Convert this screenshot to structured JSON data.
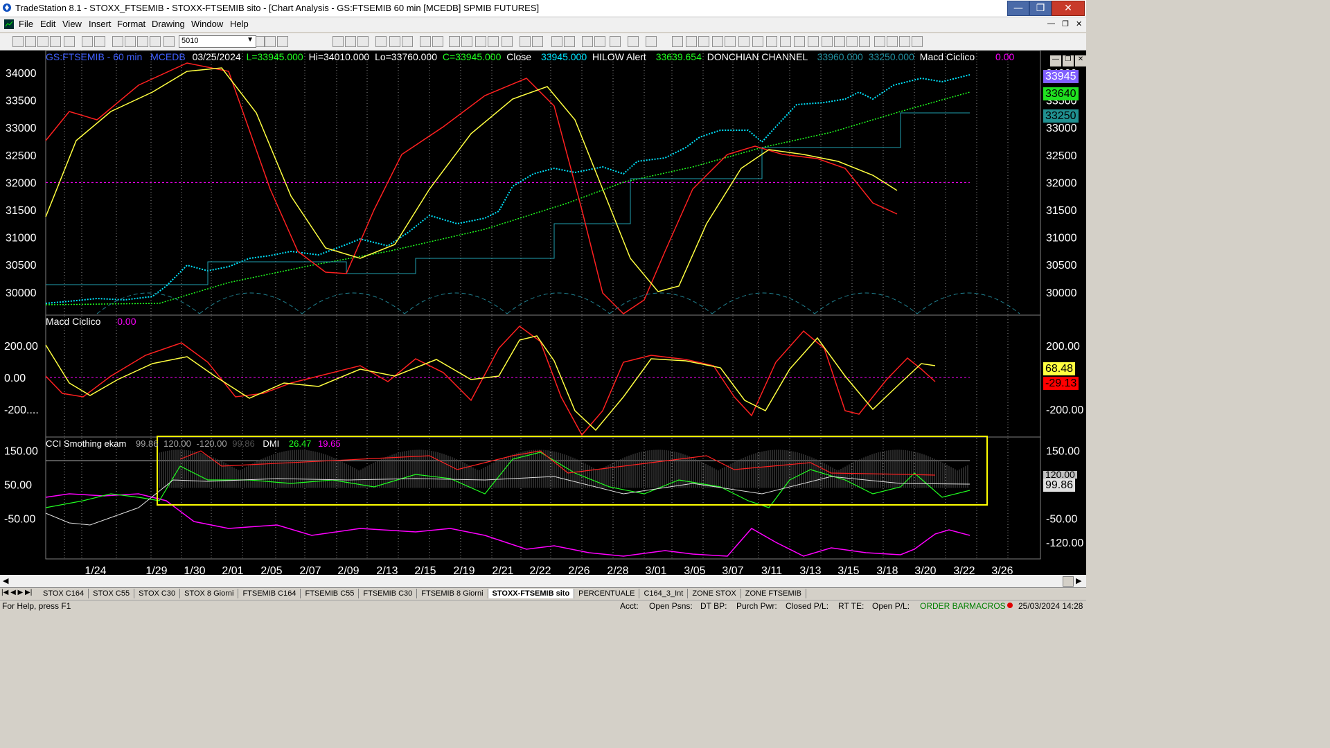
{
  "window": {
    "title": "TradeStation 8.1 - STOXX_FTSEMIB - STOXX-FTSEMIB sito - [Chart Analysis - GS:FTSEMIB  60 min  [MCEDB] SPMIB FUTURES]"
  },
  "menu": [
    "File",
    "View",
    "Insert",
    "Format",
    "Drawing",
    "Window",
    "Help"
  ],
  "toolbar": {
    "symbol_value": "5010"
  },
  "header": {
    "symbol": "GS:FTSEMIB - 60 min",
    "feed": "MCEDB",
    "date": "03/25/2024",
    "last": "L=33945.000",
    "hi": "Hi=34010.000",
    "lo": "Lo=33760.000",
    "close_c": "C=33945.000",
    "close_label": "Close",
    "close_val": "33945.000",
    "hilow_label": "HILOW Alert",
    "hilow_val": "33639.654",
    "donch_label": "DONCHIAN CHANNEL",
    "donch_hi": "33960.000",
    "donch_lo": "33250.000",
    "macd_label": "Macd Ciclico",
    "macd_val": "0.00"
  },
  "price_axis": [
    "34000",
    "33500",
    "33000",
    "32500",
    "32000",
    "31500",
    "31000",
    "30500",
    "30000"
  ],
  "price_boxes": {
    "last": "33945",
    "hilow": "33640",
    "donch_lo": "33250"
  },
  "macd_panel": {
    "label": "Macd Ciclico",
    "value": "0.00",
    "axis": [
      "200.00",
      "0.00",
      "-200...."
    ],
    "right_axis": [
      "200.00",
      "-200.00"
    ],
    "box1": "68.48",
    "box2": "-29.13"
  },
  "cci_panel": {
    "label": "CCI Smothing ekam",
    "v1": "99.86",
    "v2": "120.00",
    "v3": "-120.00",
    "v4": "99.86",
    "dmi_label": "DMI",
    "dmi1": "26.47",
    "dmi2": "19.65",
    "axis": [
      "150.00",
      "50.00",
      "-50.00"
    ],
    "right_axis": [
      "150.00",
      "50.00",
      "-50.00",
      "-120.00"
    ],
    "box_hi": "120.00",
    "box_val": "99.86"
  },
  "date_axis": [
    "1/24",
    "1/29",
    "1/30",
    "2/01",
    "2/05",
    "2/07",
    "2/09",
    "2/13",
    "2/15",
    "2/19",
    "2/21",
    "2/22",
    "2/26",
    "2/28",
    "3/01",
    "3/05",
    "3/07",
    "3/11",
    "3/13",
    "3/15",
    "3/18",
    "3/20",
    "3/22",
    "3/26"
  ],
  "tabs": [
    "STOX C164",
    "STOX C55",
    "STOX  C30",
    "STOX  8 Giorni",
    "FTSEMIB C164",
    "FTSEMIB C55",
    "FTSEMIB C30",
    "FTSEMIB  8 Giorni",
    "STOXX-FTSEMIB sito",
    "PERCENTUALE",
    "C164_3_Int",
    "ZONE STOX",
    "ZONE FTSEMIB"
  ],
  "active_tab": "STOXX-FTSEMIB sito",
  "status": {
    "help": "For Help, press F1",
    "acct": "Acct:",
    "open_psns": "Open Psns:",
    "dt_bp": "DT BP:",
    "purch": "Purch Pwr:",
    "closed": "Closed P/L:",
    "rt_te": "RT TE:",
    "open_pl": "Open P/L:",
    "order_bar": "ORDER BAR",
    "macros": "MACROS",
    "datetime": "25/03/2024 14:28"
  },
  "colors": {
    "price": "#00e5ff",
    "red": "#ff2020",
    "yellow": "#ffff40",
    "green": "#20ff20",
    "magenta": "#ff00ff",
    "donchian": "#20a0b0"
  }
}
